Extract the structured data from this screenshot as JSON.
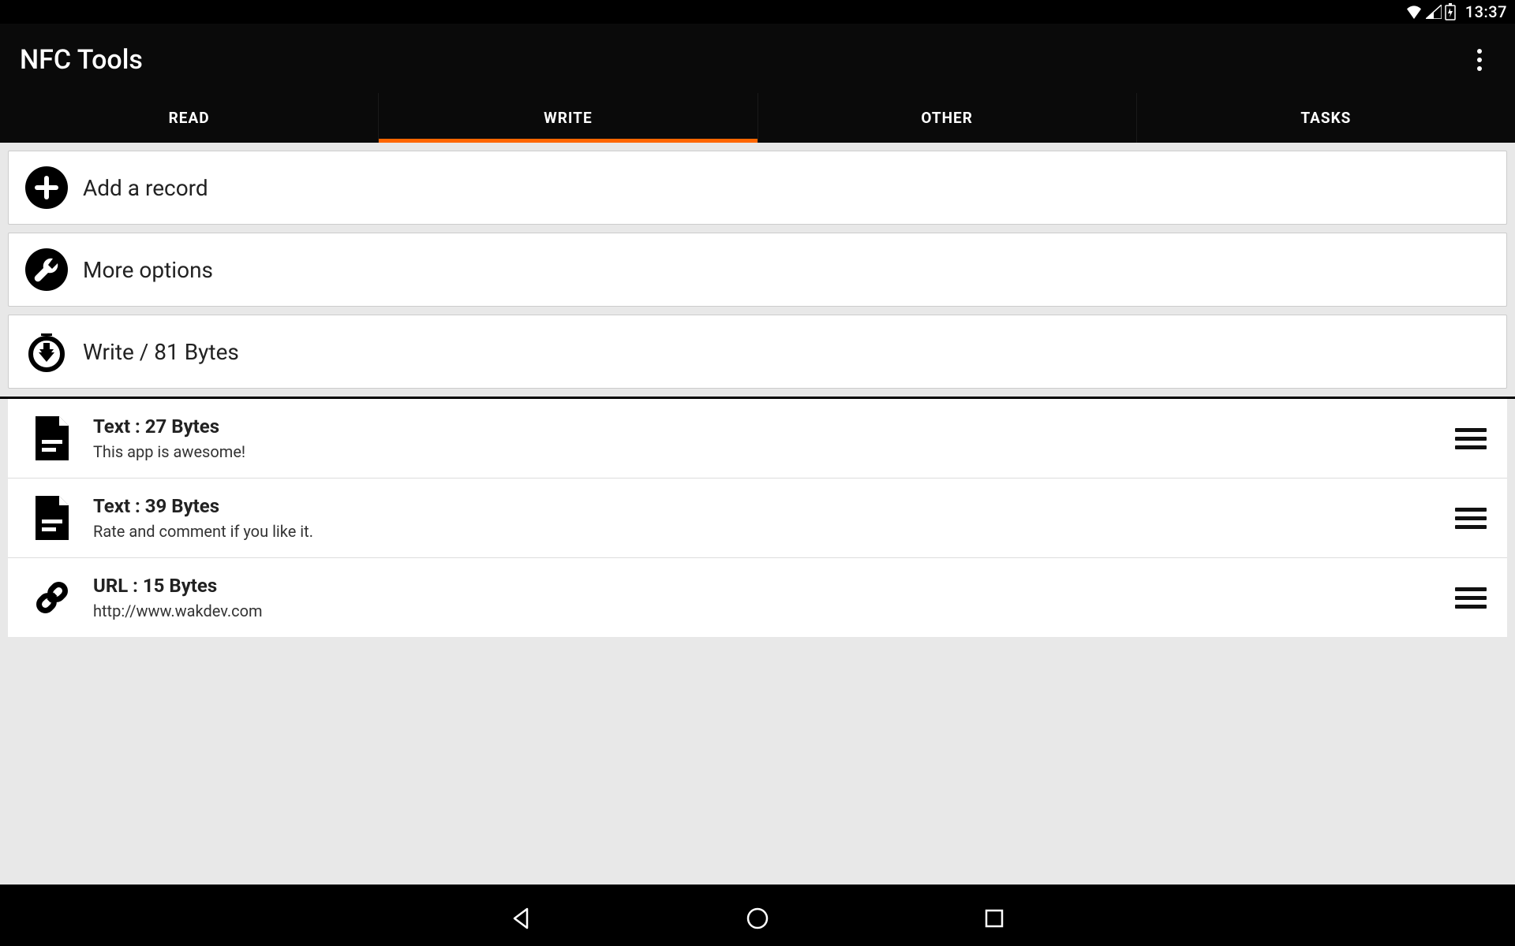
{
  "status": {
    "time": "13:37"
  },
  "app": {
    "title": "NFC Tools"
  },
  "tabs": {
    "read": "READ",
    "write": "WRITE",
    "other": "OTHER",
    "tasks": "TASKS",
    "active": "write"
  },
  "actions": {
    "add_record": "Add a record",
    "more_options": "More options",
    "write": "Write / 81 Bytes"
  },
  "records": [
    {
      "icon": "doc",
      "title": "Text : 27 Bytes",
      "sub": "This app is awesome!"
    },
    {
      "icon": "doc",
      "title": "Text : 39 Bytes",
      "sub": "Rate and comment if you like it."
    },
    {
      "icon": "link",
      "title": "URL : 15 Bytes",
      "sub": "http://www.wakdev.com"
    }
  ]
}
